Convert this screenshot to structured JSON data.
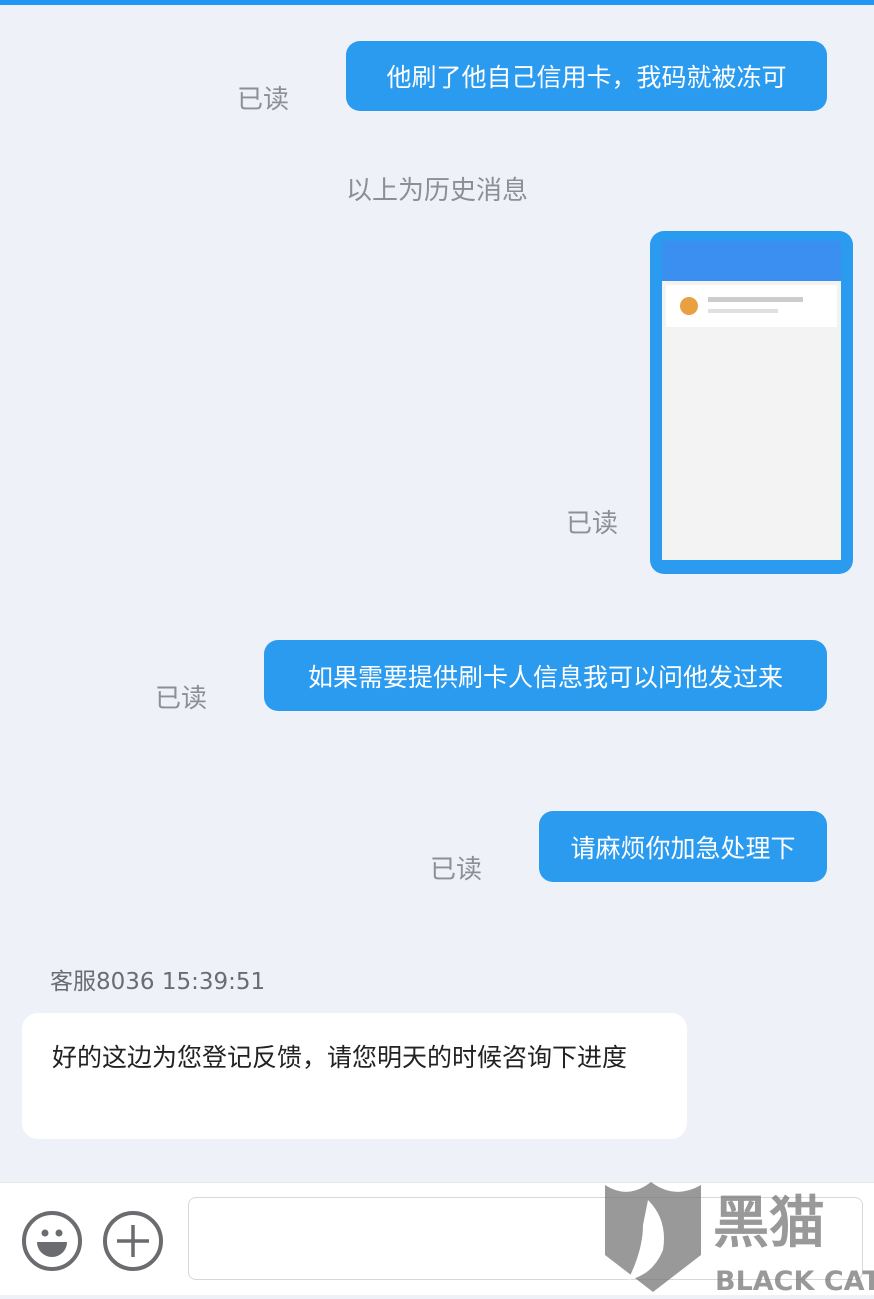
{
  "messages": [
    {
      "text": "他刷了他自己信用卡，我码就被冻可",
      "status": "已读"
    },
    {
      "type": "image",
      "status": "已读"
    },
    {
      "text": "如果需要提供刷卡人信息我可以问他发过来",
      "status": "已读"
    },
    {
      "text": "请麻烦你加急处理下",
      "status": "已读"
    }
  ],
  "system_notice": "以上为历史消息",
  "agent": {
    "label": "客服8036 15:39:51",
    "text": "好的这边为您登记反馈，请您明天的时候咨询下进度"
  },
  "input": {
    "placeholder": ""
  },
  "icons": {
    "emoji": "smiley-face-icon",
    "add": "plus-circle-icon"
  },
  "watermark": {
    "cn": "黑猫",
    "en": "BLACK CAT"
  },
  "colors": {
    "accent": "#2b9bf0",
    "background": "#eef2f8"
  }
}
